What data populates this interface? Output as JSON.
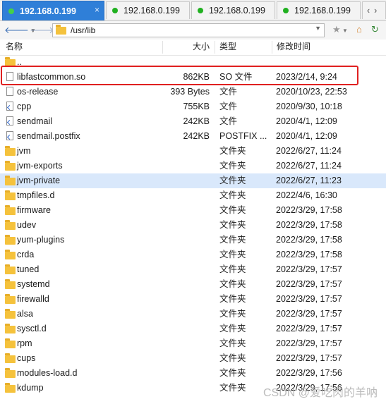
{
  "tabs": [
    {
      "label": "192.168.0.199",
      "active": true,
      "close": "×"
    },
    {
      "label": "192.168.0.199",
      "active": false
    },
    {
      "label": "192.168.0.199",
      "active": false
    },
    {
      "label": "192.168.0.199",
      "active": false
    }
  ],
  "toolbar": {
    "path": "/usr/lib",
    "back_icon": "arrow-left-icon",
    "forward_icon": "arrow-right-icon"
  },
  "columns": {
    "name": "名称",
    "size": "大小",
    "type": "类型",
    "modified": "修改时间"
  },
  "files": [
    {
      "name": "..",
      "size": "",
      "type": "",
      "modified": "",
      "kind": "folder"
    },
    {
      "name": "libfastcommon.so",
      "size": "862KB",
      "type": "SO 文件",
      "modified": "2023/2/14, 9:24",
      "kind": "file"
    },
    {
      "name": "os-release",
      "size": "393 Bytes",
      "type": "文件",
      "modified": "2020/10/23, 22:53",
      "kind": "file"
    },
    {
      "name": "cpp",
      "size": "755KB",
      "type": "文件",
      "modified": "2020/9/30, 10:18",
      "kind": "shortcut"
    },
    {
      "name": "sendmail",
      "size": "242KB",
      "type": "文件",
      "modified": "2020/4/1, 12:09",
      "kind": "shortcut"
    },
    {
      "name": "sendmail.postfix",
      "size": "242KB",
      "type": "POSTFIX ...",
      "modified": "2020/4/1, 12:09",
      "kind": "shortcut"
    },
    {
      "name": "jvm",
      "size": "",
      "type": "文件夹",
      "modified": "2022/6/27, 11:24",
      "kind": "folder"
    },
    {
      "name": "jvm-exports",
      "size": "",
      "type": "文件夹",
      "modified": "2022/6/27, 11:24",
      "kind": "folder"
    },
    {
      "name": "jvm-private",
      "size": "",
      "type": "文件夹",
      "modified": "2022/6/27, 11:23",
      "kind": "folder"
    },
    {
      "name": "tmpfiles.d",
      "size": "",
      "type": "文件夹",
      "modified": "2022/4/6, 16:30",
      "kind": "folder"
    },
    {
      "name": "firmware",
      "size": "",
      "type": "文件夹",
      "modified": "2022/3/29, 17:58",
      "kind": "folder"
    },
    {
      "name": "udev",
      "size": "",
      "type": "文件夹",
      "modified": "2022/3/29, 17:58",
      "kind": "folder"
    },
    {
      "name": "yum-plugins",
      "size": "",
      "type": "文件夹",
      "modified": "2022/3/29, 17:58",
      "kind": "folder"
    },
    {
      "name": "crda",
      "size": "",
      "type": "文件夹",
      "modified": "2022/3/29, 17:58",
      "kind": "folder"
    },
    {
      "name": "tuned",
      "size": "",
      "type": "文件夹",
      "modified": "2022/3/29, 17:57",
      "kind": "folder"
    },
    {
      "name": "systemd",
      "size": "",
      "type": "文件夹",
      "modified": "2022/3/29, 17:57",
      "kind": "folder"
    },
    {
      "name": "firewalld",
      "size": "",
      "type": "文件夹",
      "modified": "2022/3/29, 17:57",
      "kind": "folder"
    },
    {
      "name": "alsa",
      "size": "",
      "type": "文件夹",
      "modified": "2022/3/29, 17:57",
      "kind": "folder"
    },
    {
      "name": "sysctl.d",
      "size": "",
      "type": "文件夹",
      "modified": "2022/3/29, 17:57",
      "kind": "folder"
    },
    {
      "name": "rpm",
      "size": "",
      "type": "文件夹",
      "modified": "2022/3/29, 17:57",
      "kind": "folder"
    },
    {
      "name": "cups",
      "size": "",
      "type": "文件夹",
      "modified": "2022/3/29, 17:57",
      "kind": "folder"
    },
    {
      "name": "modules-load.d",
      "size": "",
      "type": "文件夹",
      "modified": "2022/3/29, 17:56",
      "kind": "folder"
    },
    {
      "name": "kdump",
      "size": "",
      "type": "文件夹",
      "modified": "2022/3/29, 17:56",
      "kind": "folder"
    }
  ],
  "highlighted_row": "jvm-private",
  "watermark": "CSDN @爱吃肉的羊呐",
  "colors": {
    "tab_active": "#2f7fd8",
    "status_dot": "#20b020",
    "folder": "#f5c23c",
    "row_highlight": "#d9e8fb",
    "selection_box": "#e02020"
  }
}
